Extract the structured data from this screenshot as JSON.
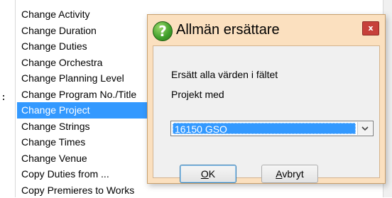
{
  "menu": {
    "items": [
      {
        "label": "Change Activity"
      },
      {
        "label": "Change Duration"
      },
      {
        "label": "Change Duties"
      },
      {
        "label": "Change Orchestra"
      },
      {
        "label": "Change Planning Level"
      },
      {
        "label": "Change Program No./Title"
      },
      {
        "label": "Change Project",
        "selected": true
      },
      {
        "label": "Change Strings"
      },
      {
        "label": "Change Times"
      },
      {
        "label": "Change Venue"
      },
      {
        "label": "Copy Duties from ..."
      },
      {
        "label": "Copy Premieres to Works"
      }
    ]
  },
  "dialog": {
    "title": "Allmän ersättare",
    "close_label": "x",
    "help_icon_glyph": "?",
    "message_line1": "Ersätt alla värden i fältet",
    "message_line2": "Projekt med",
    "select": {
      "value": "16150 GSO"
    },
    "ok_label_mnemonic": "O",
    "ok_label_rest": "K",
    "cancel_label_mnemonic": "A",
    "cancel_label_rest": "vbryt"
  },
  "colors": {
    "selection": "#3399ff",
    "dialog_frame": "#fbe0bf",
    "close_button": "#c7403a",
    "help_icon": "#3e9e2a"
  }
}
